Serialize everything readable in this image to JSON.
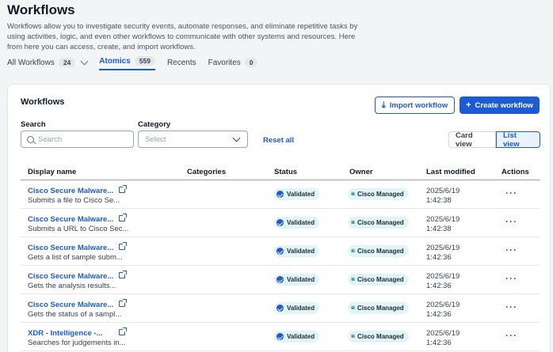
{
  "page": {
    "title": "Workflows",
    "description": "Workflows allow you to investigate security events, automate responses, and eliminate repetitive tasks by using activities, logic, and even other workflows to communicate with other systems and resources. Here from here you can access, create, and import workflows."
  },
  "tabs": [
    {
      "label": "All Workflows",
      "count": "24"
    },
    {
      "label": "Atomics",
      "count": "559"
    },
    {
      "label": "Recents",
      "count": ""
    },
    {
      "label": "Favorites",
      "count": "0"
    }
  ],
  "card": {
    "title": "Workflows",
    "import_label": "Import workflow",
    "create_label": "Create workflow",
    "search_label": "Search",
    "search_placeholder": "Search",
    "category_label": "Category",
    "category_placeholder": "Select",
    "reset_label": "Reset all",
    "card_view_label": "Card view",
    "list_view_label": "List view"
  },
  "table": {
    "headers": {
      "name": "Display name",
      "categories": "Categories",
      "status": "Status",
      "owner": "Owner",
      "modified": "Last modified",
      "actions": "Actions"
    },
    "rows": [
      {
        "name": "Cisco Secure Malware...",
        "desc": "Submits a file to Cisco Se...",
        "status": "Validated",
        "owner": "Cisco Managed",
        "date": "2025/6/19",
        "time": "1:42:38",
        "actions": "···"
      },
      {
        "name": "Cisco Secure Malware...",
        "desc": "Submits a URL to Cisco Sec...",
        "status": "Validated",
        "owner": "Cisco Managed",
        "date": "2025/6/19",
        "time": "1:42:38",
        "actions": "···"
      },
      {
        "name": "Cisco Secure Malware...",
        "desc": "Gets a list of sample subm...",
        "status": "Validated",
        "owner": "Cisco Managed",
        "date": "2025/6/19",
        "time": "1:42:36",
        "actions": "···"
      },
      {
        "name": "Cisco Secure Malware...",
        "desc": "Gets the analysis results...",
        "status": "Validated",
        "owner": "Cisco Managed",
        "date": "2025/6/19",
        "time": "1:42:36",
        "actions": "···"
      },
      {
        "name": "Cisco Secure Malware...",
        "desc": "Gets the status of a sampl...",
        "status": "Validated",
        "owner": "Cisco Managed",
        "date": "2025/6/19",
        "time": "1:42:36",
        "actions": "···"
      },
      {
        "name": "XDR - Intelligence -...",
        "desc": "Searches for judgements in...",
        "status": "Validated",
        "owner": "Cisco Managed",
        "date": "2025/6/19",
        "time": "1:42:36",
        "actions": "···"
      }
    ]
  },
  "colors": {
    "accent": "#1d5bd6",
    "badge_bg": "#e1f4f6",
    "page_bg": "#f3f4f6"
  }
}
